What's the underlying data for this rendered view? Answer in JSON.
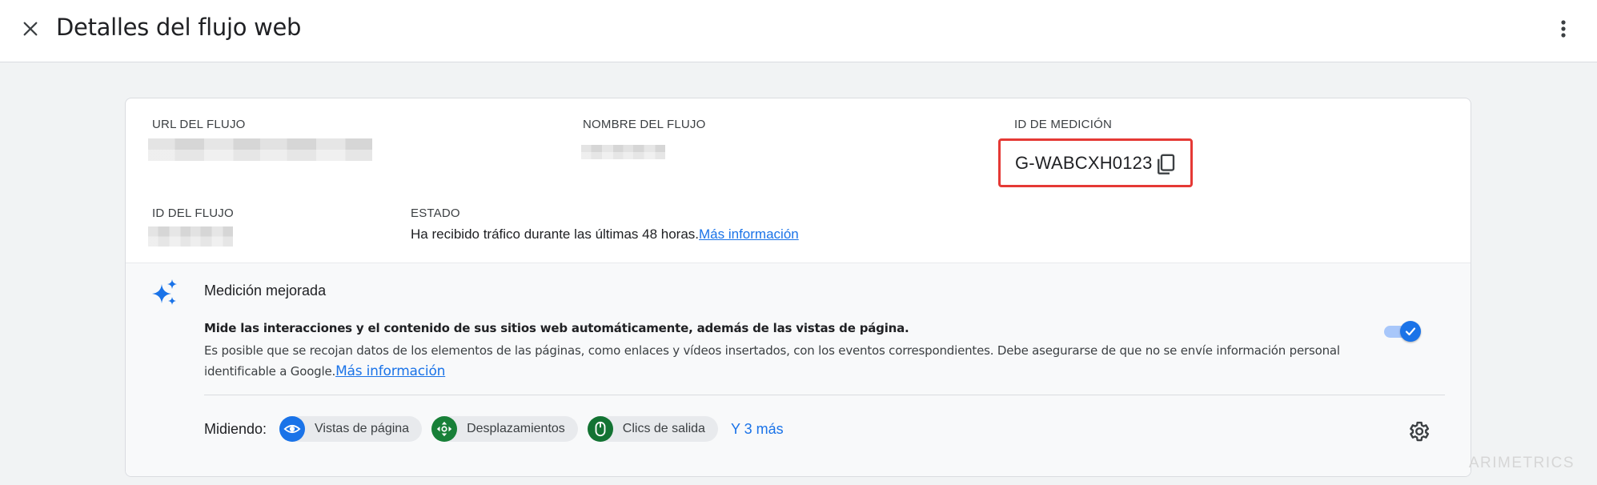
{
  "header": {
    "title": "Detalles del flujo web",
    "close_icon": "close-icon",
    "more_icon": "more-vert-icon"
  },
  "stream": {
    "url_label": "URL DEL FLUJO",
    "name_label": "NOMBRE DEL FLUJO",
    "measurement_id_label": "ID DE MEDICIÓN",
    "measurement_id": "G-WABCXH0123",
    "stream_id_label": "ID DEL FLUJO",
    "status_label": "ESTADO",
    "status_text": "Ha recibido tráfico durante las últimas 48 horas.",
    "status_link": "Más información"
  },
  "enhanced_measurement": {
    "title": "Medición mejorada",
    "description_bold": "Mide las interacciones y el contenido de sus sitios web automáticamente, además de las vistas de página.",
    "description": "Es posible que se recojan datos de los elementos de las páginas, como enlaces y vídeos insertados, con los eventos correspondientes. Debe asegurarse de que no se envíe información personal identificable a Google.",
    "description_link": "Más información",
    "toggle_enabled": true,
    "measuring_label": "Midiendo:",
    "chips": [
      {
        "label": "Vistas de página",
        "icon": "eye-icon",
        "color": "#1a73e8"
      },
      {
        "label": "Desplazamientos",
        "icon": "scroll-arrows-icon",
        "color": "#188038"
      },
      {
        "label": "Clics de salida",
        "icon": "mouse-icon",
        "color": "#137333"
      }
    ],
    "more_link": "Y 3 más"
  },
  "colors": {
    "accent": "#1a73e8",
    "highlight_border": "#e53935"
  },
  "watermark": "ARIMETRICS"
}
